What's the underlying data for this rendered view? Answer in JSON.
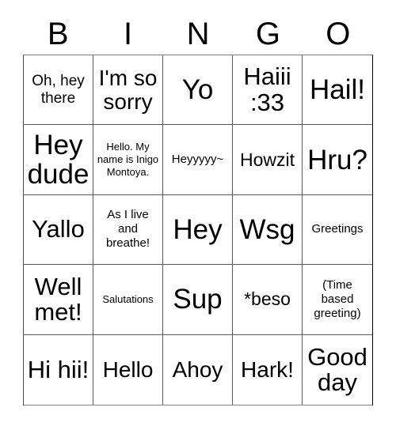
{
  "card": {
    "headers": [
      "B",
      "I",
      "N",
      "G",
      "O"
    ],
    "rows": [
      [
        {
          "text": "Oh, hey there",
          "size": "sm"
        },
        {
          "text": "I'm so sorry",
          "size": "lg"
        },
        {
          "text": "Yo",
          "size": "xxl"
        },
        {
          "text": "Haiii :33",
          "size": "xl"
        },
        {
          "text": "Hail!",
          "size": "xxl"
        }
      ],
      [
        {
          "text": "Hey dude",
          "size": "xxl"
        },
        {
          "text": "Hello. My name is Inigo Montoya.",
          "size": "xxs"
        },
        {
          "text": "Heyyyyy~",
          "size": "xs"
        },
        {
          "text": "Howzit",
          "size": "md"
        },
        {
          "text": "Hru?",
          "size": "xxl"
        }
      ],
      [
        {
          "text": "Yallo",
          "size": "xl"
        },
        {
          "text": "As I live and breathe!",
          "size": "xs"
        },
        {
          "text": "Hey",
          "size": "xxl"
        },
        {
          "text": "Wsg",
          "size": "xxl"
        },
        {
          "text": "Greetings",
          "size": "xs"
        }
      ],
      [
        {
          "text": "Well met!",
          "size": "xl"
        },
        {
          "text": "Salutations",
          "size": "xxs"
        },
        {
          "text": "Sup",
          "size": "xxl"
        },
        {
          "text": "*beso",
          "size": "md"
        },
        {
          "text": "(Time based greeting)",
          "size": "xs"
        }
      ],
      [
        {
          "text": "Hi hii!",
          "size": "xl"
        },
        {
          "text": "Hello",
          "size": "lg"
        },
        {
          "text": "Ahoy",
          "size": "lg"
        },
        {
          "text": "Hark!",
          "size": "lg"
        },
        {
          "text": "Good day",
          "size": "xl"
        }
      ]
    ]
  },
  "colors": {
    "background": "#ffffff",
    "text": "#000000",
    "grid_line": "#5a5a5a"
  }
}
